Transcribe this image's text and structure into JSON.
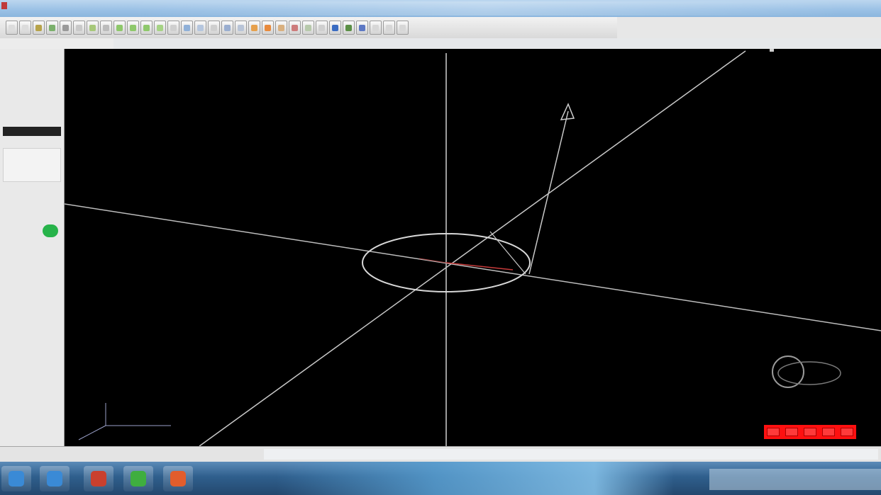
{
  "window": {
    "title": "",
    "center_title": ""
  },
  "toolbar": {
    "buttons": [
      {
        "icon": "left-arrow-icon",
        "label": "",
        "color": "#dcdcdc"
      },
      {
        "icon": "page-icon",
        "label": "",
        "color": "#dcdcdc"
      },
      {
        "icon": "tool-icon",
        "label": "",
        "color": "#b7a34a"
      },
      {
        "icon": "grid-icon",
        "label": "",
        "color": "#7bb06c"
      },
      {
        "icon": "cube-icon",
        "label": "",
        "color": "#9a9a9a"
      },
      {
        "icon": "view-icon",
        "label": "",
        "color": "#c9c9c9"
      },
      {
        "icon": "view-icon",
        "label": "",
        "color": "#a7c87a"
      },
      {
        "icon": "view-icon",
        "label": "",
        "color": "#bcbcbc"
      },
      {
        "icon": "view-icon",
        "label": "",
        "color": "#8ec86b"
      },
      {
        "icon": "view-icon",
        "label": "",
        "color": "#8ec86b"
      },
      {
        "icon": "view-icon",
        "label": "",
        "color": "#8ec86b"
      },
      {
        "icon": "view-icon",
        "label": "",
        "color": "#a6d385"
      },
      {
        "icon": "view-icon",
        "label": "",
        "color": "#cfcfcf"
      },
      {
        "icon": "view-icon",
        "label": "",
        "color": "#8fb0d8"
      },
      {
        "icon": "view-icon",
        "label": "",
        "color": "#b5c6de"
      },
      {
        "icon": "view-icon",
        "label": "",
        "color": "#cfcfcf"
      },
      {
        "icon": "view-icon",
        "label": "",
        "color": "#9aaed0"
      },
      {
        "icon": "view-icon",
        "label": "",
        "color": "#b8c4d7"
      },
      {
        "icon": "view-icon",
        "label": "",
        "color": "#e6a04c"
      },
      {
        "icon": "view-icon",
        "label": "",
        "color": "#e88a3c"
      },
      {
        "icon": "view-icon",
        "label": "",
        "color": "#d9b07f"
      },
      {
        "icon": "view-icon",
        "label": "",
        "color": "#cd7b7b"
      },
      {
        "icon": "view-icon",
        "label": "",
        "color": "#b7c9ab"
      },
      {
        "icon": "view-icon",
        "label": "",
        "color": "#cfcfcf"
      },
      {
        "icon": "view-icon",
        "label": "",
        "color": "#3a6cc2"
      },
      {
        "icon": "view-icon",
        "label": "",
        "color": "#5a8f45"
      },
      {
        "icon": "view-icon",
        "label": "",
        "color": "#5d78c4"
      },
      {
        "icon": "view-icon",
        "label": "",
        "color": "#d7d7d7"
      },
      {
        "icon": "view-icon",
        "label": "",
        "color": "#d7d7d7"
      },
      {
        "icon": "view-icon",
        "label": "",
        "color": "#d7d7d7"
      }
    ]
  },
  "menu": {
    "items": [
      "",
      "",
      "",
      ""
    ]
  },
  "left_panel": {
    "tree_items": [
      {
        "label": ""
      },
      {
        "label": ""
      },
      {
        "label": ""
      },
      {
        "label": ""
      },
      {
        "label": ""
      },
      {
        "label": ""
      },
      {
        "label": ""
      },
      {
        "label": ""
      },
      {
        "label": "",
        "selected": true
      },
      {
        "label": ""
      }
    ],
    "options": [
      {
        "label": ""
      },
      {
        "label": ""
      },
      {
        "label": ""
      },
      {
        "label": ""
      },
      {
        "label": ""
      },
      {
        "label": ""
      },
      {
        "label": ""
      },
      {
        "label": ""
      },
      {
        "label": ""
      },
      {
        "label": ""
      },
      {
        "label": ""
      }
    ]
  },
  "viewport": {
    "background": "#000000",
    "line_color": "#c8c8c8",
    "accent_color": "#ff1010",
    "coord_label": ""
  },
  "statusbar": {
    "text": ""
  },
  "taskbar": {
    "apps": [
      {
        "icon": "start-icon",
        "label": "",
        "color": "#3a8ad6"
      },
      {
        "icon": "browser-icon",
        "label": "",
        "color": "#3a8ad6"
      },
      {
        "icon": "app-icon",
        "label": "",
        "color": "#c9402e"
      },
      {
        "icon": "app-icon",
        "label": "",
        "color": "#3fae3f"
      },
      {
        "icon": "app-icon",
        "label": "",
        "color": "#e25d2c"
      }
    ]
  }
}
